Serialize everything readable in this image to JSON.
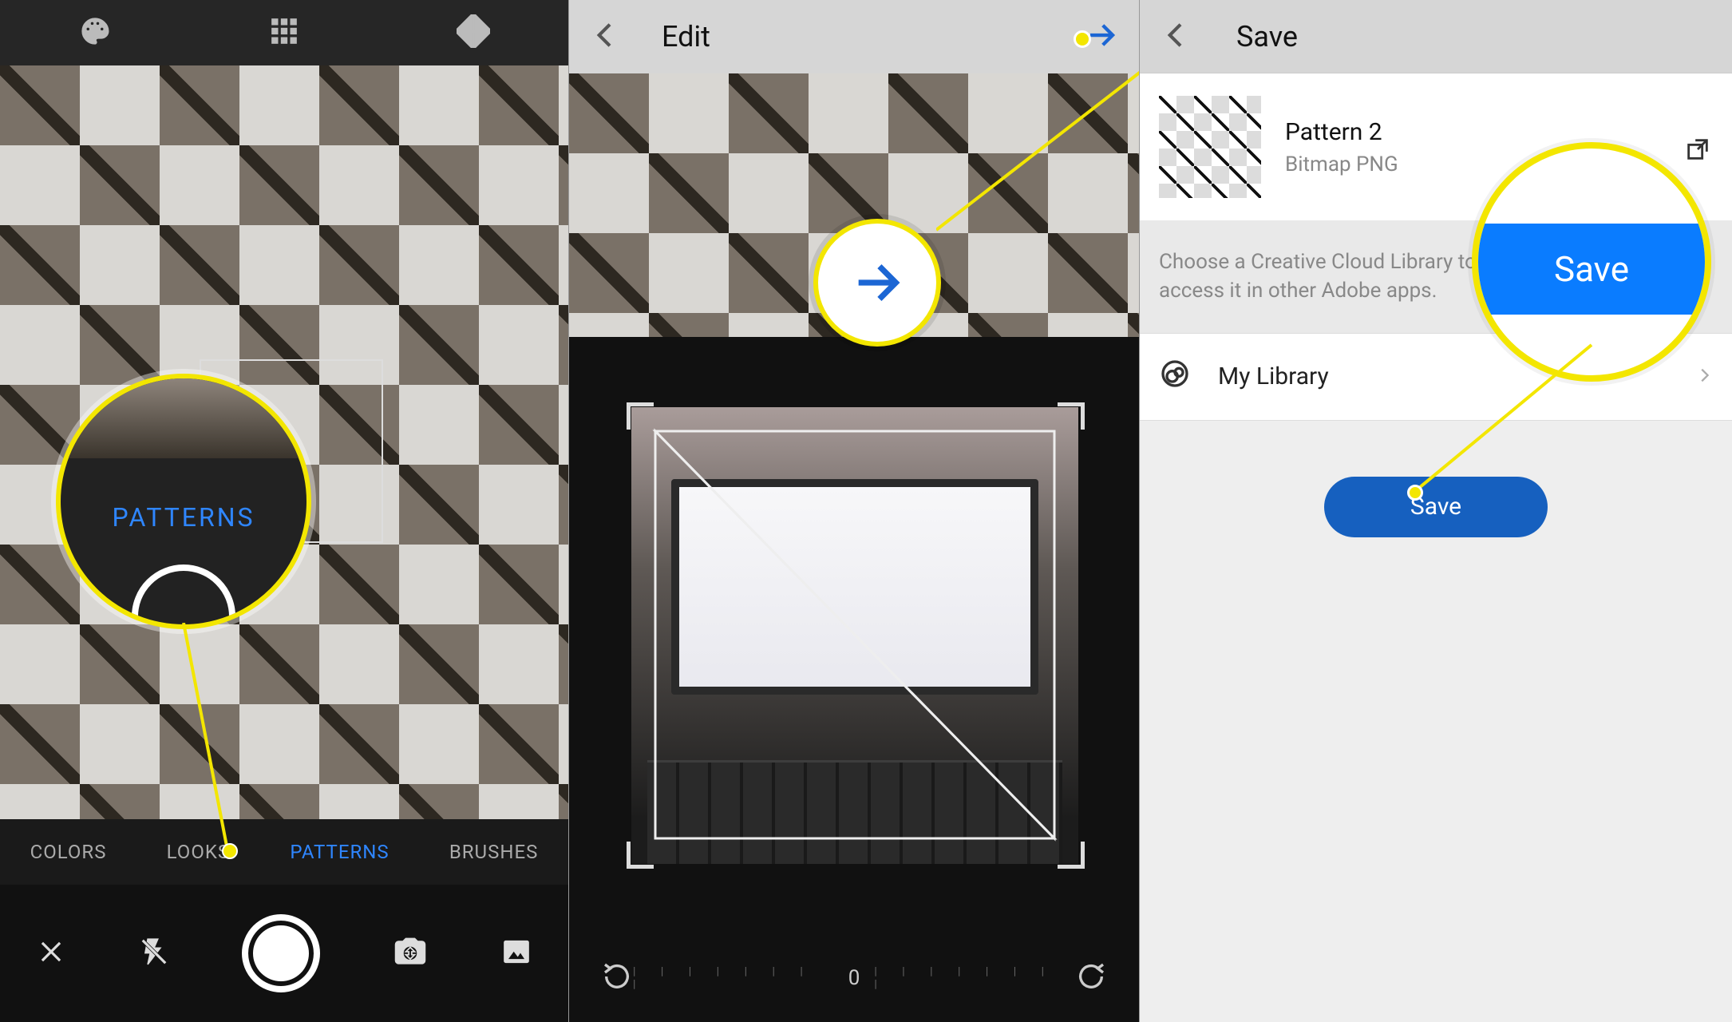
{
  "panel1": {
    "top_icons": [
      "palette-icon",
      "grid-icon",
      "kaleido-icon"
    ],
    "tabs": [
      {
        "label": "COLORS",
        "active": false
      },
      {
        "label": "LOOKS",
        "active": false
      },
      {
        "label": "PATTERNS",
        "active": true
      },
      {
        "label": "BRUSHES",
        "active": false
      }
    ],
    "controls": [
      "close",
      "flash-off",
      "shutter",
      "switch-camera",
      "gallery"
    ],
    "callout_label": "PATTERNS"
  },
  "panel2": {
    "title": "Edit",
    "rotation_value": "0"
  },
  "panel3": {
    "title": "Save",
    "pattern_name": "Pattern 2",
    "pattern_format": "Bitmap PNG",
    "description": "Choose a Creative Cloud Library to save this asset to and access it in other Adobe apps.",
    "library_row": "My Library",
    "save_button": "Save",
    "callout_label": "Save"
  }
}
